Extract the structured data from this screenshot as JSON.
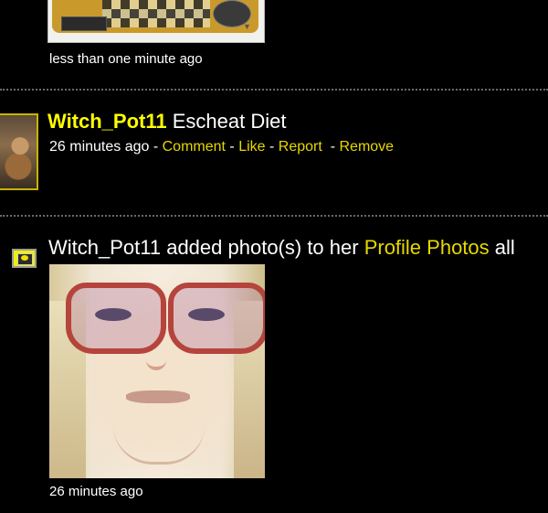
{
  "feed": {
    "entry1": {
      "time": "less than one minute ago"
    },
    "entry2": {
      "user": "Witch_Pot11",
      "text": "Escheat Diet",
      "time": "26 minutes ago",
      "sep1": " - ",
      "comment": "Comment",
      "sep2": " - ",
      "like": "Like",
      "sep3": " - ",
      "report": "Report",
      "sep4": "  - ",
      "remove": "Remove"
    },
    "entry3": {
      "text": "Witch_Pot11 added photo(s) to her ",
      "album_link": "Profile Photos",
      "trail": " all",
      "time": "26 minutes ago"
    }
  },
  "colors": {
    "background": "#000000",
    "username": "#ffff00",
    "link": "#e6d800",
    "text": "#ffffff",
    "divider": "#6a6a6a"
  },
  "icons": {
    "photo_badge": "photo-album-icon",
    "top_chevron": "chevron-down-icon"
  }
}
